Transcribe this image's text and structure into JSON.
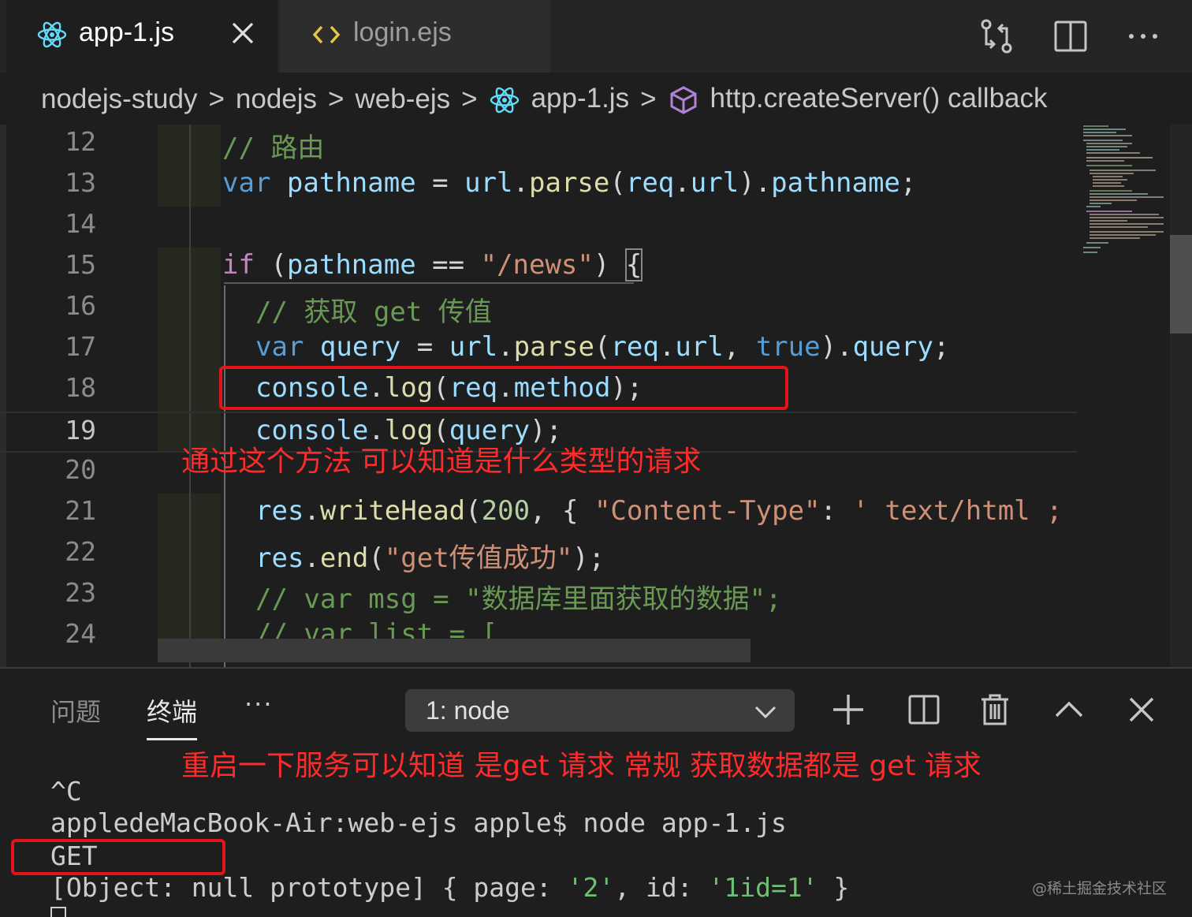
{
  "tabs": [
    {
      "label": "app-1.js",
      "icon": "react-icon",
      "active": true
    },
    {
      "label": "login.ejs",
      "icon": "code-brackets-icon",
      "active": false
    }
  ],
  "breadcrumb": {
    "items": [
      "nodejs-study",
      "nodejs",
      "web-ejs",
      "app-1.js",
      "http.createServer() callback"
    ],
    "separator": ">"
  },
  "editor": {
    "line_numbers": [
      "12",
      "13",
      "14",
      "15",
      "16",
      "17",
      "18",
      "19",
      "20",
      "21",
      "22",
      "23",
      "24"
    ],
    "lines": {
      "l12": {
        "c1": "// 路由"
      },
      "l13": {
        "kw": "var",
        "v1": "pathname",
        "op": " = ",
        "v2": "url",
        "dot1": ".",
        "fn": "parse",
        "p1": "(",
        "v3": "req",
        "dot2": ".",
        "v4": "url",
        "p2": ").",
        "v5": "pathname",
        "end": ";"
      },
      "l15": {
        "kw": "if",
        "p1": " (",
        "v1": "pathname",
        "op": " == ",
        "s1": "\"/news\"",
        "p2": ") ",
        "brace": "{"
      },
      "l16": {
        "c1": "// 获取 get 传值"
      },
      "l17": {
        "kw": "var",
        "v1": "query",
        "op": " = ",
        "v2": "url",
        "dot1": ".",
        "fn": "parse",
        "p1": "(",
        "v3": "req",
        "dot2": ".",
        "v4": "url",
        "comma": ", ",
        "kw2": "true",
        "p2": ").",
        "v5": "query",
        "end": ";"
      },
      "l18": {
        "v1": "console",
        "dot1": ".",
        "fn": "log",
        "p1": "(",
        "v2": "req",
        "dot2": ".",
        "v3": "method",
        "end": ");"
      },
      "l19": {
        "v1": "console",
        "dot1": ".",
        "fn": "log",
        "p1": "(",
        "v2": "query",
        "end": ");"
      },
      "l21": {
        "v1": "res",
        "dot1": ".",
        "fn": "writeHead",
        "p1": "(",
        "n1": "200",
        "p2": ", { ",
        "s1": "\"Content-Type\"",
        "p3": ": ",
        "s2": "' text/html ;"
      },
      "l22": {
        "v1": "res",
        "dot1": ".",
        "fn": "end",
        "p1": "(",
        "s1": "\"get传值成功\"",
        "end": ");"
      },
      "l23": {
        "c1": "// var msg = \"数据库里面获取的数据\";"
      },
      "l24": {
        "c1": "// var list = ["
      }
    },
    "annotation": "通过这个方法 可以知道是什么类型的请求"
  },
  "panel": {
    "tabs": [
      "问题",
      "终端"
    ],
    "active_tab": "终端",
    "more": "···",
    "terminal_select": "1: node",
    "annotation": "重启一下服务可以知道 是get 请求 常规 获取数据都是 get 请求",
    "terminal": {
      "l1": "^C",
      "l2": "appledeMacBook-Air:web-ejs apple$ node app-1.js",
      "l3": "GET",
      "l4": {
        "a": "[Object: null prototype] { page: ",
        "s1": "'2'",
        "b": ", id: ",
        "s2": "'1id=1'",
        "c": " }"
      }
    }
  },
  "watermark": "@稀土掘金技术社区",
  "colors": {
    "annotation": "#ff2a2a",
    "redbox": "#e3141a",
    "comment": "#6a9955",
    "keyword": "#569cd6",
    "variable": "#9cdcfe",
    "function": "#dcdcaa",
    "string": "#ce9178"
  }
}
